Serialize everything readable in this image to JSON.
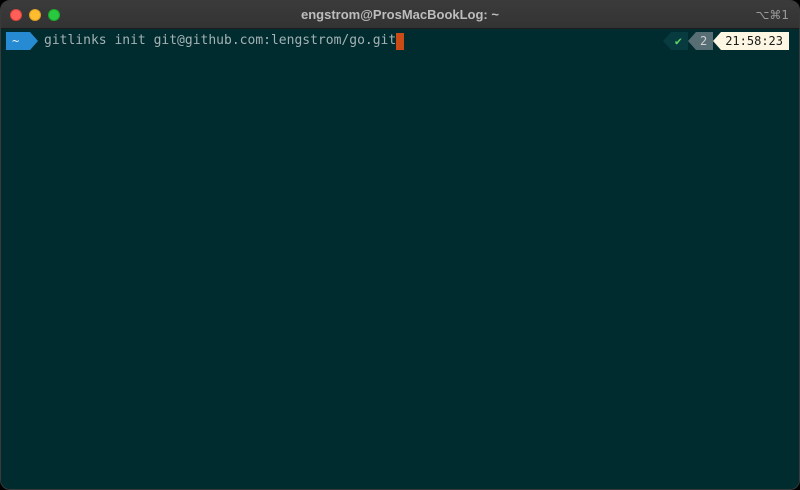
{
  "window": {
    "title": "engstrom@ProsMacBookLog: ~",
    "shortcut": "⌥⌘1"
  },
  "prompt": {
    "dir": "~",
    "command": "gitlinks init git@github.com:lengstrom/go.git"
  },
  "right_prompt": {
    "status": "✔",
    "jobs": "2",
    "time": "21:58:23"
  },
  "colors": {
    "background": "#002b2f",
    "dir_segment": "#268bd2",
    "cursor": "#cb4b16",
    "status_ok": "#5fd75f",
    "time_segment": "#fdf6e3"
  },
  "icons": {
    "close": "close-icon",
    "minimize": "minimize-icon",
    "maximize": "maximize-icon",
    "status": "checkmark-icon"
  }
}
